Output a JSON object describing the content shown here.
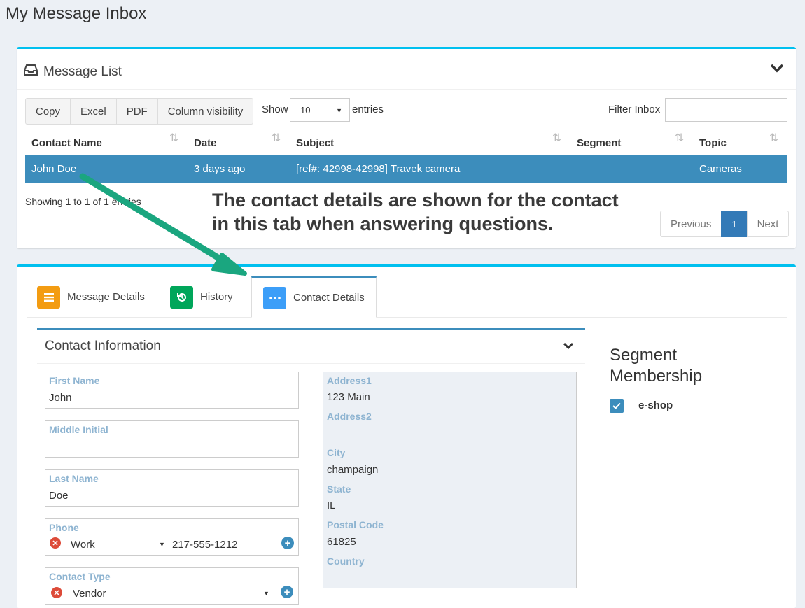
{
  "page": {
    "title": "My Message Inbox"
  },
  "message_list": {
    "title": "Message List",
    "buttons": [
      "Copy",
      "Excel",
      "PDF",
      "Column visibility"
    ],
    "show_label": "Show",
    "show_value": "10",
    "entries_label": "entries",
    "filter_label": "Filter Inbox",
    "filter_value": "",
    "columns": [
      "Contact Name",
      "Date",
      "Subject",
      "Segment",
      "Topic"
    ],
    "rows": [
      {
        "contact": "John Doe",
        "date": "3 days ago",
        "subject": "[ref#: 42998-42998] Travek camera",
        "segment": "",
        "topic": "Cameras"
      }
    ],
    "info": "Showing 1 to 1 of 1 entries",
    "pagination": {
      "previous": "Previous",
      "current": "1",
      "next": "Next"
    }
  },
  "annotation": {
    "line1": "The contact details are shown for the contact",
    "line2": "in this tab when answering questions."
  },
  "tabs": [
    {
      "label": "Message Details",
      "icon": "list-icon",
      "color": "#f39c12"
    },
    {
      "label": "History",
      "icon": "history-icon",
      "color": "#00a65a"
    },
    {
      "label": "Contact Details",
      "icon": "ellipsis-icon",
      "color": "#3c9ef8",
      "active": true
    }
  ],
  "contact_info": {
    "title": "Contact Information",
    "first_name": {
      "label": "First Name",
      "value": "John"
    },
    "middle_initial": {
      "label": "Middle Initial",
      "value": ""
    },
    "last_name": {
      "label": "Last Name",
      "value": "Doe"
    },
    "phone": {
      "label": "Phone",
      "type": "Work",
      "number": "217-555-1212"
    },
    "contact_type": {
      "label": "Contact Type",
      "value": "Vendor"
    },
    "address": {
      "address1": {
        "label": "Address1",
        "value": "123 Main"
      },
      "address2": {
        "label": "Address2",
        "value": ""
      },
      "city": {
        "label": "City",
        "value": "champaign"
      },
      "state": {
        "label": "State",
        "value": "IL"
      },
      "postal_code": {
        "label": "Postal Code",
        "value": "61825"
      },
      "country": {
        "label": "Country",
        "value": ""
      }
    }
  },
  "segments": {
    "title_line1": "Segment",
    "title_line2": "Membership",
    "items": [
      {
        "label": "e-shop",
        "checked": true
      }
    ]
  },
  "colors": {
    "accent": "#00c0ef",
    "selected_row": "#3c8dbc",
    "arrow": "#1aa67f",
    "label": "#8eb4d1"
  }
}
